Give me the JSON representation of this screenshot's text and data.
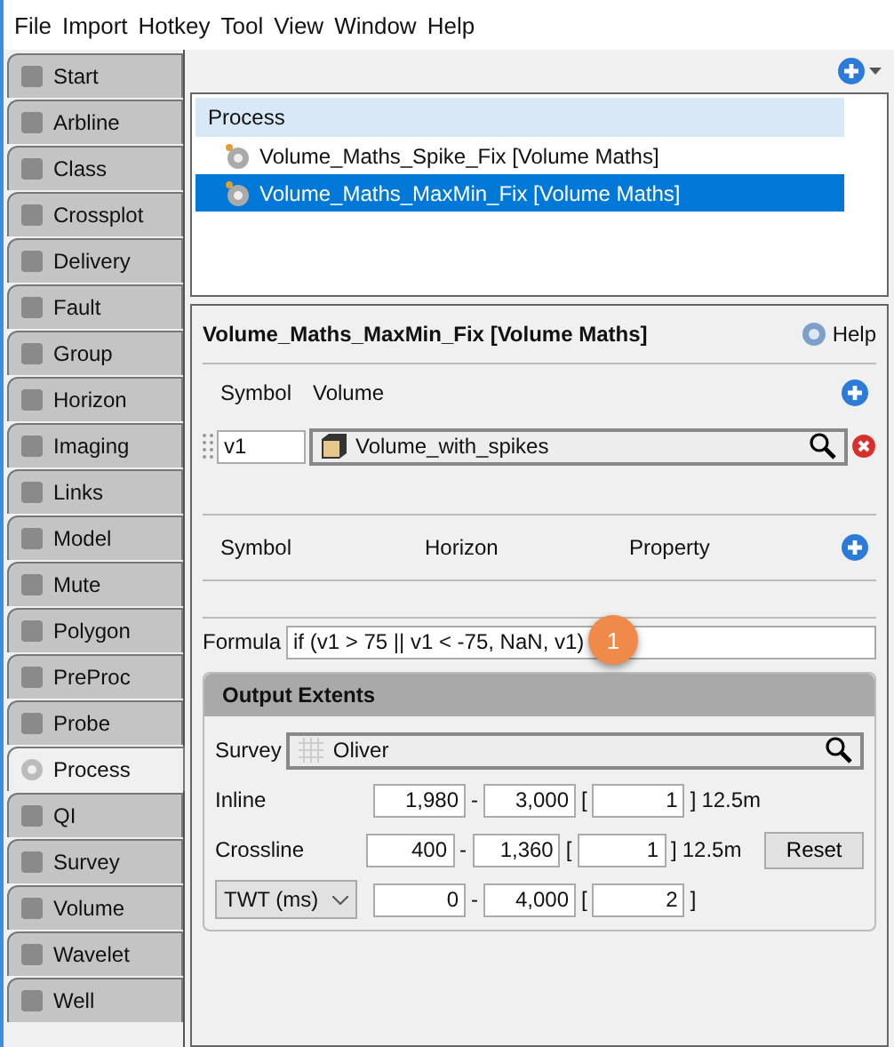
{
  "menu": [
    "File",
    "Import",
    "Hotkey",
    "Tool",
    "View",
    "Window",
    "Help"
  ],
  "sidebar": {
    "items": [
      {
        "label": "Start",
        "selected": false
      },
      {
        "label": "Arbline",
        "selected": false
      },
      {
        "label": "Class",
        "selected": false
      },
      {
        "label": "Crossplot",
        "selected": false
      },
      {
        "label": "Delivery",
        "selected": false
      },
      {
        "label": "Fault",
        "selected": false
      },
      {
        "label": "Group",
        "selected": false
      },
      {
        "label": "Horizon",
        "selected": false
      },
      {
        "label": "Imaging",
        "selected": false
      },
      {
        "label": "Links",
        "selected": false
      },
      {
        "label": "Model",
        "selected": false
      },
      {
        "label": "Mute",
        "selected": false
      },
      {
        "label": "Polygon",
        "selected": false
      },
      {
        "label": "PreProc",
        "selected": false
      },
      {
        "label": "Probe",
        "selected": false
      },
      {
        "label": "Process",
        "selected": true
      },
      {
        "label": "QI",
        "selected": false
      },
      {
        "label": "Survey",
        "selected": false
      },
      {
        "label": "Volume",
        "selected": false
      },
      {
        "label": "Wavelet",
        "selected": false
      },
      {
        "label": "Well",
        "selected": false
      }
    ]
  },
  "process_list": {
    "header": "Process",
    "items": [
      {
        "label": "Volume_Maths_Spike_Fix [Volume Maths]",
        "selected": false
      },
      {
        "label": "Volume_Maths_MaxMin_Fix [Volume Maths]",
        "selected": true
      }
    ]
  },
  "detail": {
    "title": "Volume_Maths_MaxMin_Fix [Volume Maths]",
    "help": "Help",
    "volume_columns": [
      "Symbol",
      "Volume"
    ],
    "volume_rows": [
      {
        "symbol": "v1",
        "volume": "Volume_with_spikes"
      }
    ],
    "horizon_columns": [
      "Symbol",
      "Horizon",
      "Property"
    ],
    "formula_label": "Formula",
    "formula": "if (v1 > 75 || v1 < -75, NaN, v1)",
    "callout": "1",
    "output_extents": {
      "title": "Output Extents",
      "survey_label": "Survey",
      "survey": "Oliver",
      "rows": [
        {
          "kind": "label",
          "label": "Inline",
          "from": "1,980",
          "dash": "-",
          "to": "3,000",
          "open": "[",
          "step": "1",
          "close": "]",
          "unit": "12.5m"
        },
        {
          "kind": "label",
          "label": "Crossline",
          "from": "400",
          "dash": "-",
          "to": "1,360",
          "open": "[",
          "step": "1",
          "close": "]",
          "unit": "12.5m",
          "button": "Reset"
        },
        {
          "kind": "dropdown",
          "label": "TWT (ms)",
          "from": "0",
          "dash": "-",
          "to": "4,000",
          "open": "[",
          "step": "2",
          "close": "]"
        }
      ]
    }
  }
}
